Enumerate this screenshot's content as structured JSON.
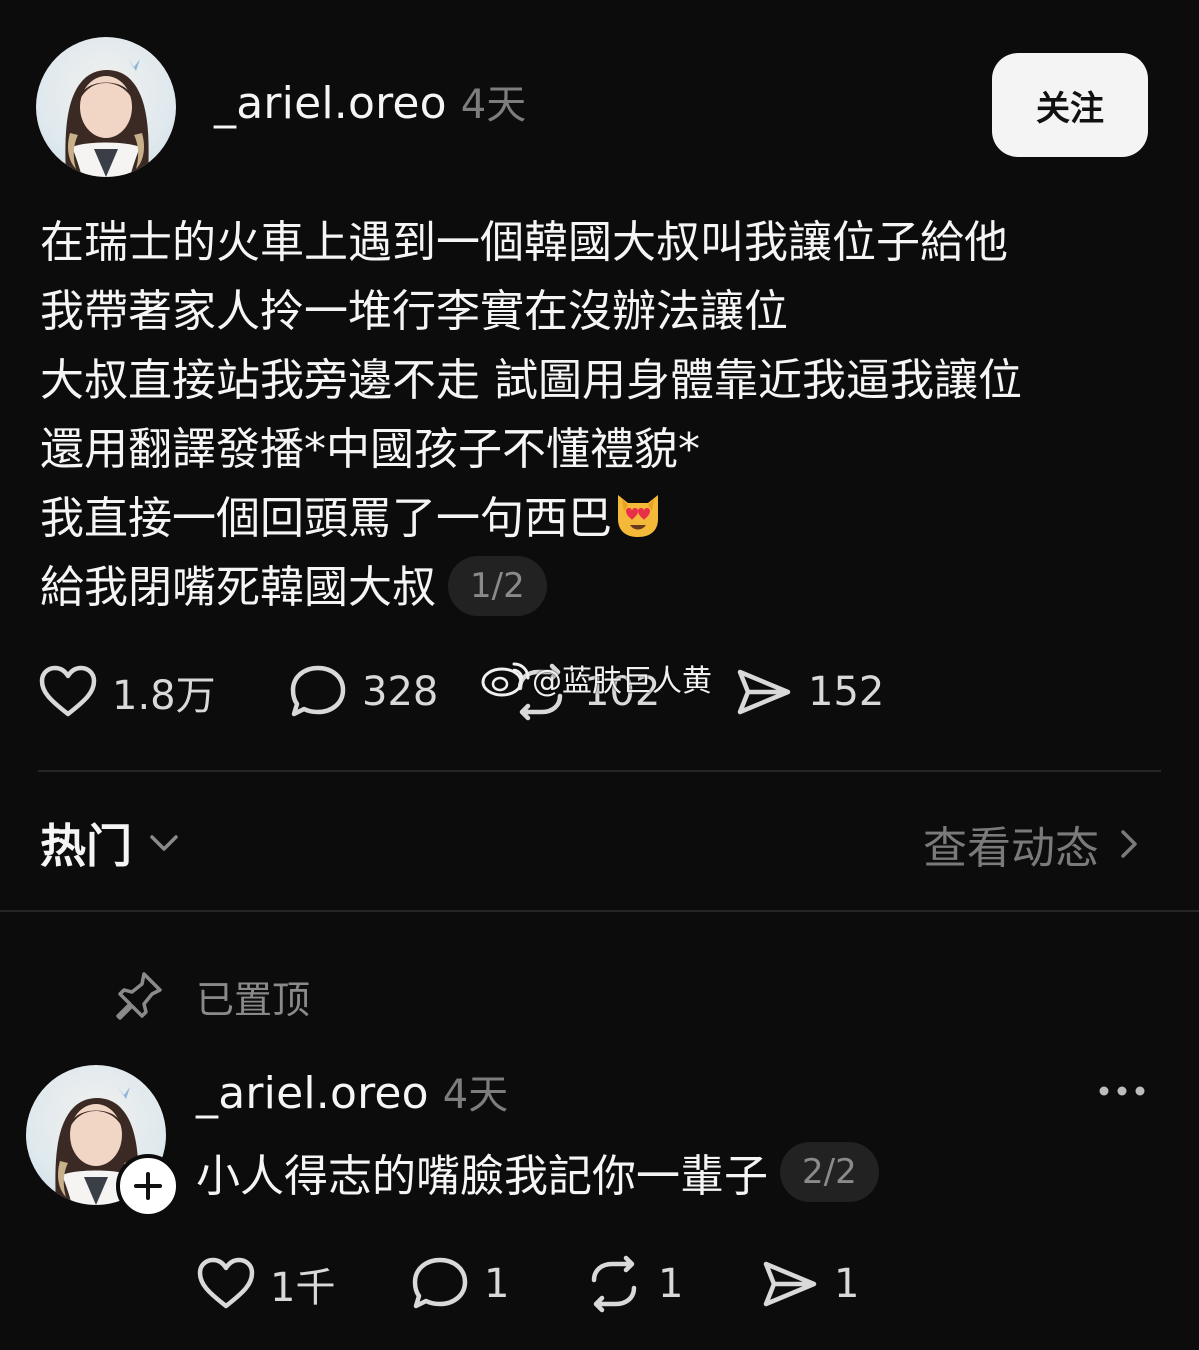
{
  "post": {
    "username": "_ariel.oreo",
    "time": "4天",
    "follow_label": "关注",
    "lines": [
      "在瑞士的火車上遇到一個韓國大叔叫我讓位子給他",
      "我帶著家人拎一堆行李實在沒辦法讓位",
      "大叔直接站我旁邊不走 試圖用身體靠近我逼我讓位",
      "還用翻譯發播*中國孩子不懂禮貌*",
      "我直接一個回頭罵了一句西巴",
      "給我閉嘴死韓國大叔"
    ],
    "page_indicator": "1/2",
    "likes": "1.8万",
    "comments": "328",
    "reposts": "102",
    "shares": "152"
  },
  "watermark": "@蓝肤巨人黄",
  "section": {
    "sort_label": "热门",
    "view_activity": "查看动态"
  },
  "pinned_label": "已置顶",
  "reply": {
    "username": "_ariel.oreo",
    "time": "4天",
    "text": "小人得志的嘴臉我記你一輩子",
    "page_indicator": "2/2",
    "likes": "1千",
    "comments": "1",
    "reposts": "1",
    "shares": "1"
  }
}
